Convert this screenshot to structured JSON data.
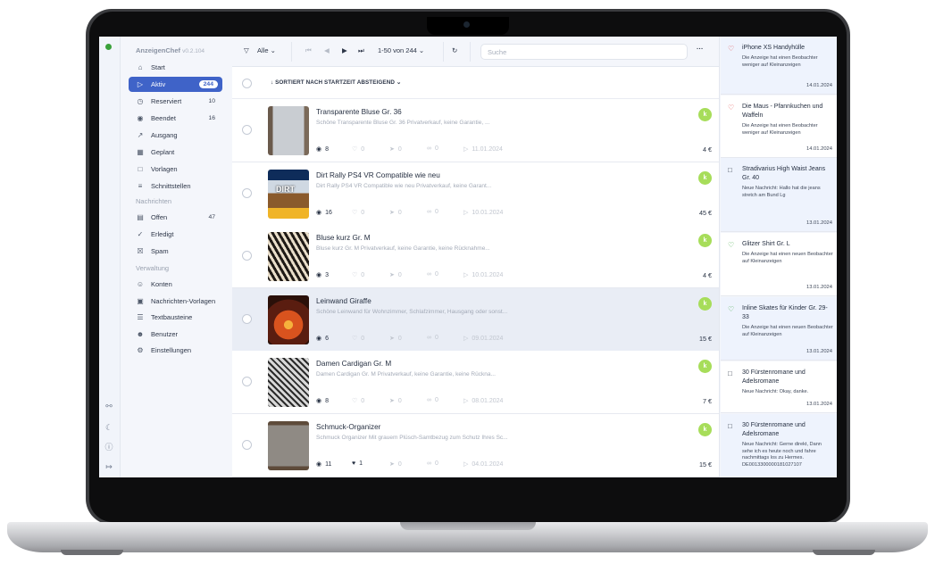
{
  "app": {
    "name": "AnzeigenChef",
    "version": "v0.2.104"
  },
  "sidebar": {
    "items": [
      {
        "label": "Start",
        "icon": "home-icon",
        "count": ""
      },
      {
        "label": "Aktiv",
        "icon": "play-circle-icon",
        "count": "244",
        "active": true
      },
      {
        "label": "Reserviert",
        "icon": "clock-icon",
        "count": "10"
      },
      {
        "label": "Beendet",
        "icon": "stop-circle-icon",
        "count": "16"
      },
      {
        "label": "Ausgang",
        "icon": "outbox-icon",
        "count": ""
      },
      {
        "label": "Geplant",
        "icon": "calendar-icon",
        "count": ""
      },
      {
        "label": "Vorlagen",
        "icon": "folder-icon",
        "count": ""
      },
      {
        "label": "Schnittstellen",
        "icon": "database-icon",
        "count": ""
      }
    ],
    "section_messages": "Nachrichten",
    "message_items": [
      {
        "label": "Offen",
        "icon": "inbox-icon",
        "count": "47"
      },
      {
        "label": "Erledigt",
        "icon": "message-check-icon",
        "count": ""
      },
      {
        "label": "Spam",
        "icon": "message-x-icon",
        "count": ""
      }
    ],
    "section_admin": "Verwaltung",
    "admin_items": [
      {
        "label": "Konten",
        "icon": "user-icon"
      },
      {
        "label": "Nachrichten-Vorlagen",
        "icon": "template-icon"
      },
      {
        "label": "Textbausteine",
        "icon": "text-block-icon"
      },
      {
        "label": "Benutzer",
        "icon": "users-icon"
      },
      {
        "label": "Einstellungen",
        "icon": "gear-icon"
      }
    ]
  },
  "toolbar": {
    "filter_label": "Alle",
    "pagination": "1-50 von 244",
    "search_placeholder": "Suche"
  },
  "sort": {
    "label": "SORTIERT NACH STARTZEIT ABSTEIGEND"
  },
  "listings": [
    {
      "title": "Transparente Bluse Gr. 36",
      "desc": "Schöne Transparente Bluse Gr. 36 Privatverkauf, keine Garantie, ...",
      "views": "8",
      "likes": "0",
      "shares": "0",
      "links": "0",
      "date": "11.01.2024",
      "price": "4 €",
      "badge": "k",
      "thumb": "blouse"
    },
    {
      "title": "Dirt Rally PS4 VR Compatible wie neu",
      "desc": "Dirt Rally PS4 VR Compatible wie neu Privatverkauf, keine Garant...",
      "views": "16",
      "likes": "0",
      "shares": "0",
      "links": "0",
      "date": "10.01.2024",
      "price": "45 €",
      "badge": "k",
      "thumb": "game",
      "thumb_text": "DIRT"
    },
    {
      "title": "Bluse kurz Gr. M",
      "desc": "Bluse kurz Gr. M Privatverkauf, keine Garantie, keine Rücknahme...",
      "views": "3",
      "likes": "0",
      "shares": "0",
      "links": "0",
      "date": "10.01.2024",
      "price": "4 €",
      "badge": "k",
      "thumb": "zebra"
    },
    {
      "title": "Leinwand Giraffe",
      "desc": "Schöne Leinwand für Wohnzimmer, Schlafzimmer, Hausgang oder sonst...",
      "views": "6",
      "likes": "0",
      "shares": "0",
      "links": "0",
      "date": "09.01.2024",
      "price": "15 €",
      "badge": "k",
      "thumb": "sunset",
      "highlight": true
    },
    {
      "title": "Damen Cardigan Gr. M",
      "desc": "Damen Cardigan Gr. M Privatverkauf, keine Garantie, keine Rückna...",
      "views": "8",
      "likes": "0",
      "shares": "0",
      "links": "0",
      "date": "08.01.2024",
      "price": "7 €",
      "badge": "k",
      "thumb": "cardigan"
    },
    {
      "title": "Schmuck-Organizer",
      "desc": "Schmuck Organizer Mit grauem Plüsch-Samtbezug zum Schutz Ihres Sc...",
      "views": "11",
      "likes": "1",
      "shares": "0",
      "links": "0",
      "date": "04.01.2024",
      "price": "15 €",
      "badge": "k",
      "thumb": "organizer"
    }
  ],
  "notifications": [
    {
      "icon": "heart-broken-icon",
      "title": "iPhone XS Handyhülle",
      "body": "Die Anzeige hat einen Beobachter weniger auf Kleinanzeigen",
      "date": "14.01.2024",
      "unread": true
    },
    {
      "icon": "heart-broken-icon",
      "title": "Die Maus - Pfannkuchen und Waffeln",
      "body": "Die Anzeige hat einen Beobachter weniger auf Kleinanzeigen",
      "date": "14.01.2024",
      "unread": false
    },
    {
      "icon": "chat-icon",
      "title": "Stradivarius High Waist Jeans Gr. 40",
      "body": "Neue Nachricht: Hallo hat die jeans stretch am Bund Lg",
      "date": "13.01.2024",
      "unread": true
    },
    {
      "icon": "heart-plus-icon",
      "title": "Glitzer Shirt Gr. L",
      "body": "Die Anzeige hat einen neuen Beobachter auf Kleinanzeigen",
      "date": "13.01.2024",
      "unread": false
    },
    {
      "icon": "heart-plus-icon",
      "title": "Inline Skates für Kinder Gr. 29-33",
      "body": "Die Anzeige hat einen neuen Beobachter auf Kleinanzeigen",
      "date": "13.01.2024",
      "unread": true
    },
    {
      "icon": "chat-icon",
      "title": "30 Fürstenromane und Adelsromane",
      "body": "Neue Nachricht: Okay, danke.",
      "date": "13.01.2024",
      "unread": false
    },
    {
      "icon": "chat-icon",
      "title": "30 Fürstenromane und Adelsromane",
      "body": "Neue Nachricht: Gerne direkt, Dann sehe ich es heute noch und fahre nachmittags los zu Hermes. DE0013300000181027107",
      "date": "",
      "unread": true
    }
  ],
  "colors": {
    "accent": "#3f63c8",
    "badge": "#a7dd5a",
    "status_online": "#3aa13a",
    "heart_remove": "#e25555",
    "heart_add": "#4caf50"
  }
}
